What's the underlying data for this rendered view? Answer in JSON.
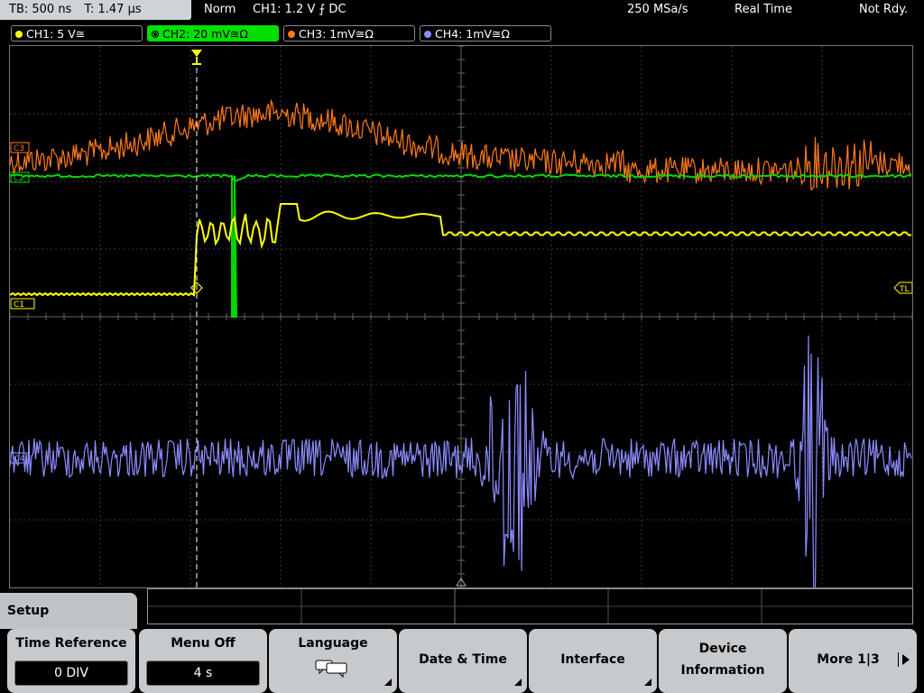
{
  "status": {
    "timebase": "TB: 500 ns",
    "trigger_time": "T: 1.47 µs",
    "mode": "Norm",
    "trigger_setting": "CH1: 1.2 V ⨍ DC",
    "sample_rate": "250 MSa/s",
    "acq_mode": "Real Time",
    "state": "Not Rdy."
  },
  "channels": [
    {
      "label": "CH1: 5 V≅",
      "color": "#ffff00",
      "active": false
    },
    {
      "label": "CH2: 20 mV≅Ω",
      "color": "#00e000",
      "active": true
    },
    {
      "label": "CH3: 1mV≅Ω",
      "color": "#ff7a1a",
      "active": false
    },
    {
      "label": "CH4: 1mV≅Ω",
      "color": "#8c8cff",
      "active": false
    }
  ],
  "markers": {
    "ch1": "C1",
    "ch2": "C2",
    "ch3": "C3",
    "ch4": "C4",
    "trigger_level": "TL"
  },
  "menu": {
    "title": "Setup",
    "softkeys": [
      {
        "label": "Time Reference",
        "value": "0 DIV"
      },
      {
        "label": "Menu Off",
        "value": "4 s"
      },
      {
        "label": "Language",
        "icon": "speech-bubbles-icon"
      },
      {
        "label": "Date & Time"
      },
      {
        "label": "Interface"
      },
      {
        "label": "Device",
        "label2": "Information"
      },
      {
        "label": "More 1|3"
      }
    ]
  }
}
